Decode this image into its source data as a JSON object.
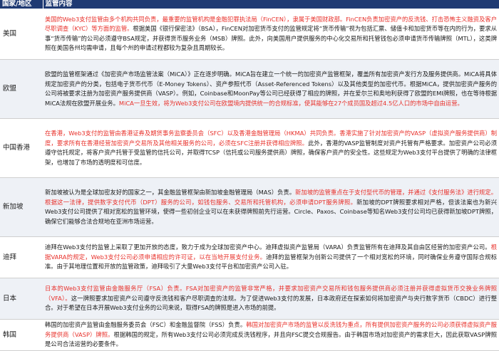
{
  "table": {
    "header": {
      "region": "国家/地区",
      "content": "监管内容"
    },
    "rows": [
      {
        "region": "美国",
        "segments": [
          {
            "text": "美国的Web3支付监管由多个机构共同负责，最重要的监管机构是金融犯罪执法局（FinCEN），隶属于美国财政部。FinCEN负责加密资产的反洗钱、打击恐怖主义融资及客户尽职调查（KYC）等方面的监管。",
            "highlight": true
          },
          {
            "text": "根据美国《银行保密法》（BSA），FinCEN对加密货币支付的监管规定将“货币传输”视为包括汇票、储值卡和加密货币等在内的行为，要求从事“货币传输”的公司必须遵守BSA规定，并获得货币服务业务（MSB）牌照。此外，向美国用户提供服务的中心化交易所和托管钱包必须申请货币传输牌照（MTL），这类牌照在美国各州均需申请，且每个州的申请过程都较为复杂且周期较长。",
            "highlight": false
          }
        ]
      },
      {
        "region": "欧盟",
        "segments": [
          {
            "text": "欧盟的监管框架通过《加密资产市场监管法案（MiCA）》正在逐步明确。MiCA旨在建立一个统一的加密资产监管框架，覆盖所有加密资产发行方及服务提供商。MiCA将具体规定加密资产的分类，包括电子货币代币（E-Money Tokens）、资产参照代币（Asset-Referenced Tokens）以及其他类型的加密代币。根据MiCA，提供加密资产服务的公司将被要求注册为加密资产服务提供商（VASP）。例如，Coinbase和MoonPay等公司已经获得了相应的牌照，并在爱尔兰和奥地利获得了欧盟的EMI牌照，也在等待根据MiCA法规在欧盟开展业务。",
            "highlight": false
          },
          {
            "text": "MiCA一旦生效，将为Web3支付公司在欧盟境内提供统一的合规标准，使其能够在27个成员国及超过4.5亿人口的市场中自由运营。",
            "highlight": true
          }
        ]
      },
      {
        "region": "中国香港",
        "segments": [
          {
            "text": "在香港，Web3支付的监管由香港证券及期货事务监察委员会（SFC）以及香港金融管理局（HKMA）共同负责。香港实施了针对加密资产的VASP（虚拟资产服务提供商）制度，要求所有在香港经营加密资产交易所及其他相关服务的公司，必须在SFC注册并获得相应牌照。",
            "highlight": true
          },
          {
            "text": "此外，香港的VASP监管制度对资产托管有严格要求。加密资产公司必须遵守信托规定，将客户资产托管于受监管的信托公司，并取得TCSP（信托或公司服务提供商）牌照，确保客户资产的安全性。这些规定为Web3支付平台提供了明确的法律框架，也增加了市场的透明度和可信度。",
            "highlight": false
          }
        ]
      },
      {
        "region": "新加坡",
        "segments": [
          {
            "text": "新加坡被认为是全球加密友好的国家之一，其金融监管框架由新加坡金融管理局（MAS）负责。",
            "highlight": false
          },
          {
            "text": "新加坡的监管重点在于支付型代币的管理，并通过《支付服务法》进行规定。根据这一法律，提供数字支付代币（DPT）服务的公司，如钱包服务、交易所和托管机构，必须申请DPT服务牌照。",
            "highlight": true
          },
          {
            "text": "新加坡的DPT牌照要求相对严格，但该法案也为新兴Web3支付公司提供了相对宽松的监管环境，使得一些初创企业可以在未获得牌照前先行运营。Circle、Paxos、Coinbase等知名Web3支付公司均已获得新加坡DPT牌照，确保它们能够合法合规地在亚洲市场运营。",
            "highlight": false
          }
        ]
      },
      {
        "region": "迪拜",
        "segments": [
          {
            "text": "迪拜在Web3支付的监管上采取了更加开放的态度，致力于成为全球加密资产中心。迪拜虚拟资产监管局（VARA）负责监管所有在迪拜及其自由区经营的加密资产公司。",
            "highlight": false
          },
          {
            "text": "根据VARA的规定，Web3支付公司必须申请相应的许可证，以在当地开展支付业务。",
            "highlight": true
          },
          {
            "text": "迪拜的监管框架为创新公司提供了一个相对宽松的环境，同时确保业务遵守国际合规标准。由于其地理位置和开放的监管政策，迪拜吸引了大量Web3支付平台和加密资产公司入驻。",
            "highlight": false
          }
        ]
      },
      {
        "region": "日本",
        "segments": [
          {
            "text": "日本的Web3支付监管由金融服务厅（FSA）负责。FSA对加密资产的监管非常严格，并要求加密资产交易所和钱包服务提供商必须注册并获得虚拟货币交换业务牌照（VFA）。",
            "highlight": true
          },
          {
            "text": "这一牌照要求加密资产公司遵守反洗钱和客户尽职调查的法规。为了促进Web3支付的发展，日本政府还在探索如何将加密资产与央行数字货币（CBDC）进行整合。对于希望在日本开展Web3支付业务的公司来说，取得FSA的牌照是进入市场的前提。",
            "highlight": false
          }
        ]
      },
      {
        "region": "韩国",
        "segments": [
          {
            "text": "韩国的加密资产监管由金融服务委员会（FSC）和金融监督院（FSS）负责。",
            "highlight": false
          },
          {
            "text": "韩国对加密资产市场的监管以反洗钱为重点，所有提供加密资产服务的公司必须获得虚拟资产服务提供商（VASP）牌照。",
            "highlight": true
          },
          {
            "text": "根据韩国的规定，所有Web3支付公司必须完成反洗钱程序，并且向FSC提交合规报告。由于韩国市场对加密资产的需求巨大，因此获取VASP牌照是公司合法运营的必要条件。",
            "highlight": false
          }
        ]
      }
    ]
  }
}
